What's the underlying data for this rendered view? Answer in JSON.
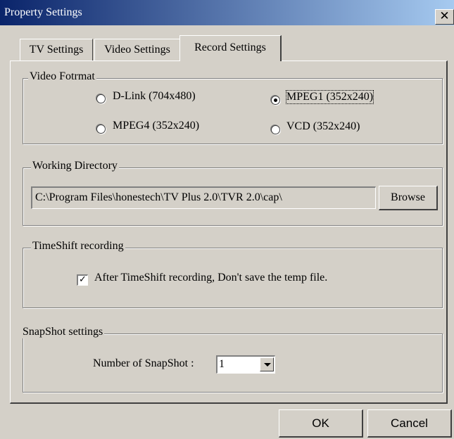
{
  "window": {
    "title": "Property Settings",
    "close_glyph": "✕"
  },
  "tabs": [
    {
      "label": "TV Settings"
    },
    {
      "label": "Video Settings"
    },
    {
      "label": "Record Settings",
      "active": true
    }
  ],
  "video_format": {
    "legend": "Video Fotrmat",
    "options": [
      {
        "label": "D-Link (704x480)",
        "selected": false
      },
      {
        "label": "MPEG1 (352x240)",
        "selected": true
      },
      {
        "label": "MPEG4 (352x240)",
        "selected": false
      },
      {
        "label": "VCD (352x240)",
        "selected": false
      }
    ]
  },
  "working_directory": {
    "legend": "Working Directory",
    "path": "C:\\Program Files\\honestech\\TV Plus 2.0\\TVR 2.0\\cap\\",
    "browse_label": "Browse"
  },
  "timeshift": {
    "legend": "TimeShift recording",
    "checkbox_label": "After TimeShift recording, Don't save the temp file.",
    "checked": true,
    "check_glyph": "✓"
  },
  "snapshot": {
    "legend": "SnapShot settings",
    "label": "Number of SnapShot :",
    "value": "1"
  },
  "footer": {
    "ok_label": "OK",
    "cancel_label": "Cancel"
  }
}
